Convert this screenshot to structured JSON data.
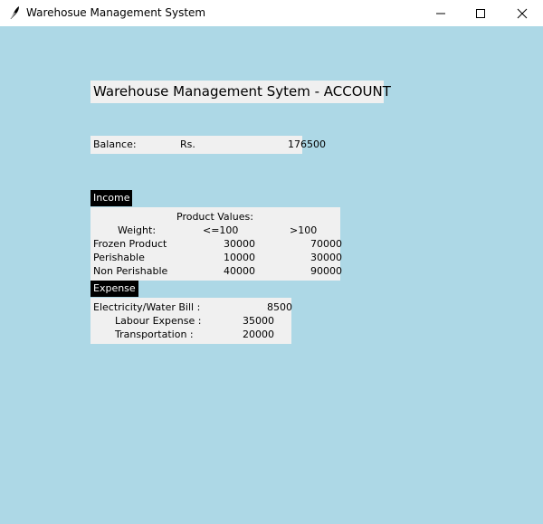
{
  "window": {
    "title": "Warehosue Management System",
    "minimize_glyph": "minimize-icon",
    "maximize_glyph": "maximize-icon",
    "close_glyph": "close-icon"
  },
  "heading": "Warehouse Management Sytem  - ACCOUNT",
  "balance": {
    "label": "Balance:",
    "currency": "Rs.",
    "amount": "176500"
  },
  "income": {
    "label": "Income",
    "product_values_header": "Product Values:",
    "weight_label": "Weight:",
    "col1": "<=100",
    "col2": ">100",
    "rows": [
      {
        "name": "Frozen Product",
        "v1": "30000",
        "v2": "70000"
      },
      {
        "name": "Perishable",
        "v1": "10000",
        "v2": "30000"
      },
      {
        "name": "Non Perishable",
        "v1": "40000",
        "v2": "90000"
      }
    ]
  },
  "expense": {
    "label": "Expense",
    "rows": [
      {
        "name": "Electricity/Water Bill :",
        "value": "8500"
      },
      {
        "name": "Labour Expense :",
        "value": "35000"
      },
      {
        "name": "Transportation :",
        "value": "20000"
      }
    ]
  },
  "colors": {
    "background": "#add8e6",
    "panel": "#f0f0f0",
    "label_bg": "#000000"
  }
}
